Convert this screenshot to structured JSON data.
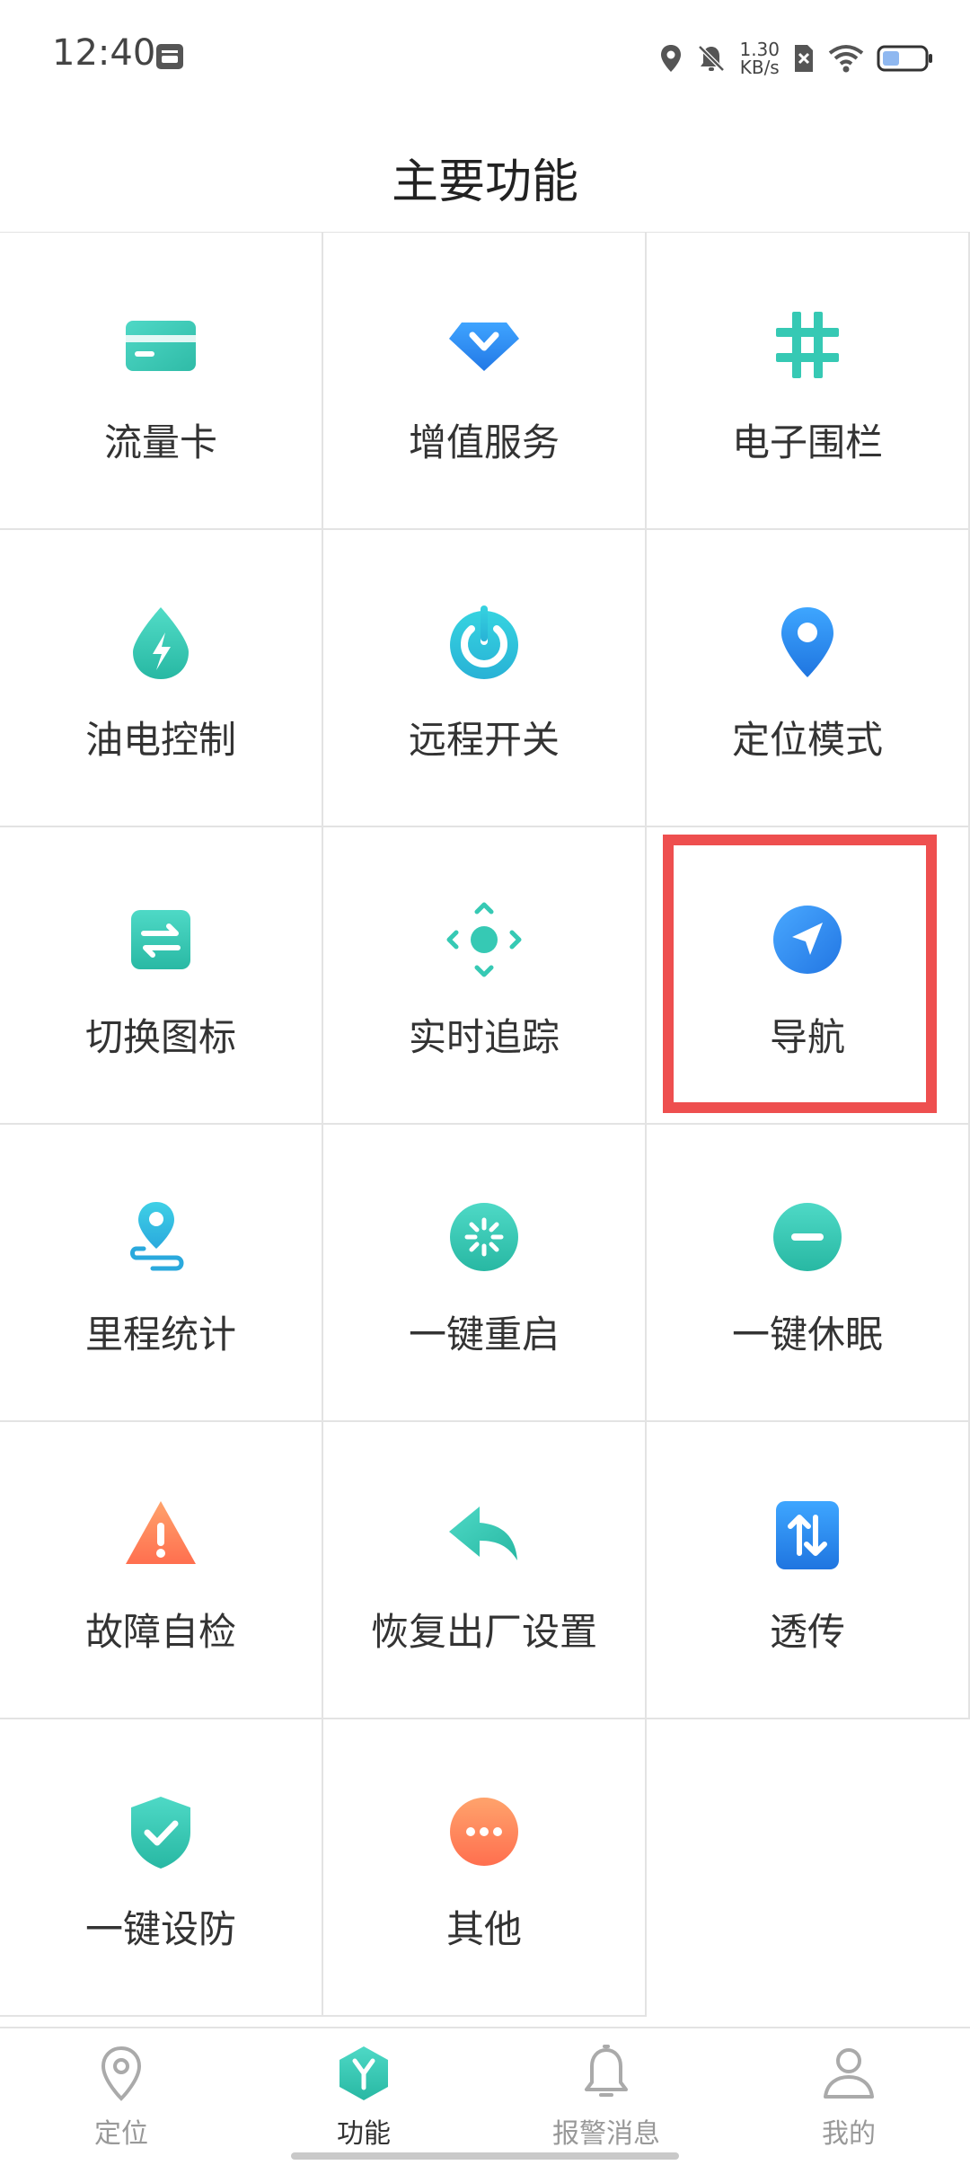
{
  "status_bar": {
    "time": "12:40",
    "speed_value": "1.30",
    "speed_unit": "KB/s"
  },
  "header": {
    "title": "主要功能"
  },
  "grid": {
    "items": [
      {
        "label": "流量卡",
        "icon": "sim-card-icon"
      },
      {
        "label": "增值服务",
        "icon": "diamond-icon"
      },
      {
        "label": "电子围栏",
        "icon": "fence-icon"
      },
      {
        "label": "油电控制",
        "icon": "oil-electric-icon"
      },
      {
        "label": "远程开关",
        "icon": "power-icon"
      },
      {
        "label": "定位模式",
        "icon": "location-pin-icon"
      },
      {
        "label": "切换图标",
        "icon": "switch-icon"
      },
      {
        "label": "实时追踪",
        "icon": "tracking-icon"
      },
      {
        "label": "导航",
        "icon": "navigation-icon"
      },
      {
        "label": "里程统计",
        "icon": "mileage-icon"
      },
      {
        "label": "一键重启",
        "icon": "restart-icon"
      },
      {
        "label": "一键休眠",
        "icon": "sleep-icon"
      },
      {
        "label": "故障自检",
        "icon": "warning-icon"
      },
      {
        "label": "恢复出厂设置",
        "icon": "reset-icon"
      },
      {
        "label": "透传",
        "icon": "transfer-icon"
      },
      {
        "label": "一键设防",
        "icon": "shield-check-icon"
      },
      {
        "label": "其他",
        "icon": "more-icon"
      }
    ]
  },
  "bottom_nav": {
    "items": [
      {
        "label": "定位",
        "icon": "location-icon"
      },
      {
        "label": "功能",
        "icon": "function-icon"
      },
      {
        "label": "报警消息",
        "icon": "bell-icon"
      },
      {
        "label": "我的",
        "icon": "user-icon"
      }
    ],
    "active": "功能"
  },
  "colors": {
    "accent_teal": "#36c9b4",
    "accent_blue": "#2f8ff0",
    "highlight_red": "#ee4f4f",
    "warning_orange": "#ff7f57"
  }
}
